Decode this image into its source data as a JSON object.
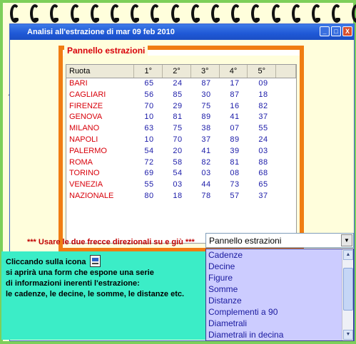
{
  "window": {
    "title": "Analisi all'estrazione di mar 09 feb 2010",
    "buttons": [
      "_",
      "□",
      "X"
    ]
  },
  "panel": {
    "title": "Pannello estrazioni",
    "columns": [
      "Ruota",
      "1°",
      "2°",
      "3°",
      "4°",
      "5°"
    ],
    "rows": [
      [
        "BARI",
        "65",
        "24",
        "87",
        "17",
        "09"
      ],
      [
        "CAGLIARI",
        "56",
        "85",
        "30",
        "87",
        "18"
      ],
      [
        "FIRENZE",
        "70",
        "29",
        "75",
        "16",
        "82"
      ],
      [
        "GENOVA",
        "10",
        "81",
        "89",
        "41",
        "37"
      ],
      [
        "MILANO",
        "63",
        "75",
        "38",
        "07",
        "55"
      ],
      [
        "NAPOLI",
        "10",
        "70",
        "37",
        "89",
        "24"
      ],
      [
        "PALERMO",
        "54",
        "20",
        "41",
        "39",
        "03"
      ],
      [
        "ROMA",
        "72",
        "58",
        "82",
        "81",
        "88"
      ],
      [
        "TORINO",
        "69",
        "54",
        "03",
        "08",
        "68"
      ],
      [
        "VENEZIA",
        "55",
        "03",
        "44",
        "73",
        "65"
      ],
      [
        "NAZIONALE",
        "80",
        "18",
        "78",
        "57",
        "37"
      ]
    ]
  },
  "hint": {
    "text": "*** Usare le due frecce direzionali su e giù ***"
  },
  "info": {
    "line1": "Cliccando sulla icona",
    "line2": "si aprirà una form che espone una serie",
    "line3": "di informazioni inerenti l'estrazione:",
    "line4": "le cadenze, le decine, le somme, le distanze etc."
  },
  "combo": {
    "selected": "Pannello estrazioni",
    "options": [
      "Cadenze",
      "Decine",
      "Figure",
      "Somme",
      "Distanze",
      "Complementi a 90",
      "Diametrali",
      "Diametrali in decina"
    ]
  },
  "colors": {
    "frame": "#7dcf5a",
    "panel_border": "#f07d12",
    "info_bg": "#3bedc7",
    "dropdown_bg": "#ccccff"
  },
  "icons": [
    "spiral-ring-icon",
    "document-icon",
    "dropdown-arrow-icon"
  ]
}
